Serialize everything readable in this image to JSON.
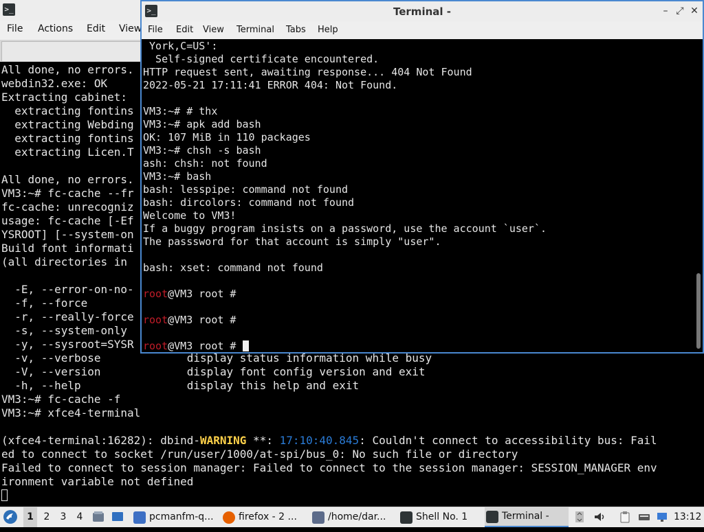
{
  "back_window": {
    "app_icon": "terminal-icon",
    "menu": [
      "File",
      "Actions",
      "Edit",
      "View"
    ],
    "lines": [
      "All done, no errors.",
      "webdin32.exe: OK",
      "Extracting cabinet: ",
      "  extracting fontins",
      "  extracting Webding",
      "  extracting fontins",
      "  extracting Licen.T",
      "",
      "All done, no errors.",
      "VM3:~# fc-cache --fr",
      "fc-cache: unrecogniz",
      "usage: fc-cache [-Ef",
      "YSROOT] [--system-on",
      "Build font informati",
      "(all directories in ",
      "",
      "  -E, --error-on-no-",
      "  -f, --force",
      "  -r, --really-force",
      "  -s, --system-only",
      "  -y, --sysroot=SYSR",
      "  -v, --verbose             display status information while busy",
      "  -V, --version             display font config version and exit",
      "  -h, --help                display this help and exit",
      "VM3:~# fc-cache -f",
      "VM3:~# xfce4-terminal",
      ""
    ],
    "warning": {
      "pre": "(xfce4-terminal:16282): dbind-",
      "level": "WARNING",
      "mid": " **: ",
      "timestamp": "17:10:40.845",
      "post": ": Couldn't connect to accessibility bus: Fail"
    },
    "lines_after": [
      "ed to connect to socket /run/user/1000/at-spi/bus_0: No such file or directory",
      "Failed to connect to session manager: Failed to connect to the session manager: SESSION_MANAGER env",
      "ironment variable not defined"
    ]
  },
  "front_window": {
    "title": "Terminal -",
    "app_icon": "terminal-icon",
    "menu": [
      "File",
      "Edit",
      "View",
      "Terminal",
      "Tabs",
      "Help"
    ],
    "lines": [
      " York,C=US':",
      "  Self-signed certificate encountered.",
      "HTTP request sent, awaiting response... 404 Not Found",
      "2022-05-21 17:11:41 ERROR 404: Not Found.",
      "",
      "VM3:~# # thx",
      "VM3:~# apk add bash",
      "OK: 107 MiB in 110 packages",
      "VM3:~# chsh -s bash",
      "ash: chsh: not found",
      "VM3:~# bash",
      "bash: lesspipe: command not found",
      "bash: dircolors: command not found",
      "Welcome to VM3!",
      "If a buggy program insists on a password, use the account `user`.",
      "The passsword for that account is simply \"user\".",
      "",
      "bash: xset: command not found",
      ""
    ],
    "prompt_user": "root",
    "prompt_rest": "@VM3 root # ",
    "prompt_count": 3,
    "scroll_position": 0.8
  },
  "taskbar": {
    "workspaces": [
      "1",
      "2",
      "3",
      "4"
    ],
    "active_workspace": "1",
    "tasks": [
      {
        "label": "pcmanfm-q...",
        "icon": "folder-icon",
        "color": "#3d6fc4"
      },
      {
        "label": "firefox - 2 ...",
        "icon": "firefox-icon",
        "color": "#e66000"
      },
      {
        "label": "/home/dar...",
        "icon": "text-editor-icon",
        "color": "#5c6b8a"
      },
      {
        "label": "Shell No. 1",
        "icon": "terminal-icon",
        "color": "#2e3436"
      },
      {
        "label": "Terminal -",
        "icon": "terminal-icon",
        "color": "#2e3436",
        "active": true
      }
    ],
    "clock": "13:12"
  },
  "colors": {
    "accent": "#4a88d0",
    "prompt_red": "#c01c28",
    "warning": "#ffd24a",
    "timestamp": "#2a7bd6"
  }
}
